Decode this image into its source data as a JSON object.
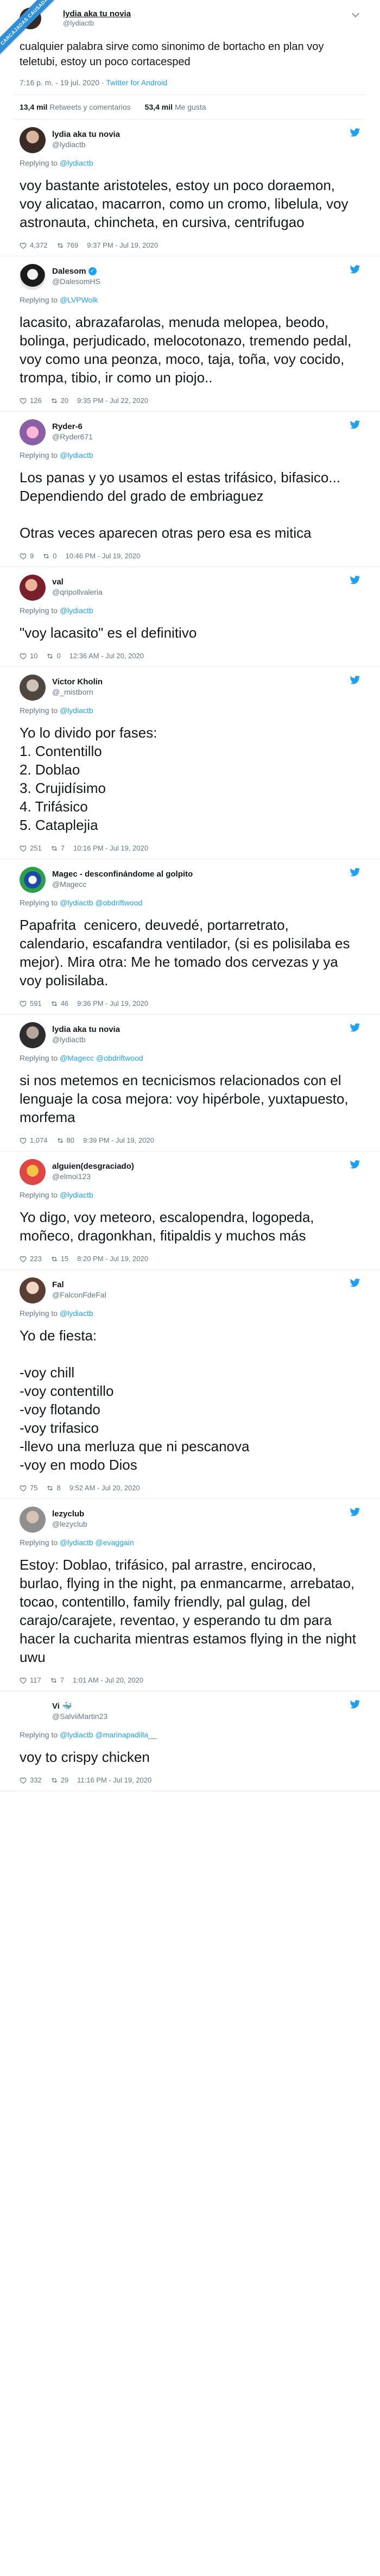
{
  "ribbon": "CARCAJADAS CAUSADAS",
  "main": {
    "name": "lydia aka tu novia",
    "handle": "@lydiactb",
    "text": "cualquier palabra sirve como sinonimo de bortacho en plan voy teletubi, estoy un poco cortacesped",
    "time": "7:16 p. m. - 19 jul. 2020 · ",
    "source": "Twitter for Android",
    "retweets_count": "13,4 mil",
    "retweets_label": "Retweets y comentarios",
    "likes_count": "53,4 mil",
    "likes_label": "Me gusta"
  },
  "replies": [
    {
      "name": "lydia aka tu novia",
      "handle": "@lydiactb",
      "verified": false,
      "replying_prefix": "Replying to ",
      "replying_to": "@lydiactb",
      "text": "voy bastante aristoteles, estoy un poco doraemon, voy alicatao, macarron, como un cromo, libelula, voy astronauta, chincheta, en cursiva, centrifugao",
      "likes": "4,372",
      "retweets": "769",
      "time": "9:37 PM - Jul 19, 2020"
    },
    {
      "name": "Dalesom",
      "handle": "@DalesomHS",
      "verified": true,
      "replying_prefix": "Replying to ",
      "replying_to": "@LVPWolk",
      "text": "lacasito, abrazafarolas, menuda melopea, beodo, bolinga, perjudicado, melocotonazo, tremendo pedal, voy como una peonza, moco, taja, toña, voy cocido, trompa, tibio, ir como un piojo..",
      "likes": "126",
      "retweets": "20",
      "time": "9:35 PM - Jul 22, 2020"
    },
    {
      "name": "Ryder-6",
      "handle": "@Ryder671",
      "verified": false,
      "replying_prefix": "Replying to ",
      "replying_to": "@lydiactb",
      "text": "Los panas y yo usamos el estas trifásico, bifasico... Dependiendo del grado de embriaguez\n\nOtras veces aparecen otras pero esa es mitica",
      "likes": "9",
      "retweets": "0",
      "time": "10:46 PM - Jul 19, 2020"
    },
    {
      "name": "val",
      "handle": "@qripollvaleria",
      "verified": false,
      "replying_prefix": "Replying to ",
      "replying_to": "@lydiactb",
      "text": "\"voy lacasito\" es el definitivo",
      "likes": "10",
      "retweets": "0",
      "time": "12:36 AM - Jul 20, 2020"
    },
    {
      "name": "Victor Kholin",
      "handle": "@_mistborn",
      "verified": false,
      "replying_prefix": "Replying to ",
      "replying_to": "@lydiactb",
      "text": "Yo lo divido por fases:\n1. Contentillo\n2. Doblao\n3. Crujidísimo\n4. Trifásico\n5. Cataplejia",
      "likes": "251",
      "retweets": "7",
      "time": "10:16 PM - Jul 19, 2020"
    },
    {
      "name": "Magec - desconfinándome al golpito",
      "handle": "@Magecc",
      "verified": false,
      "replying_prefix": "Replying to ",
      "replying_to": "@lydiactb @obdriftwood",
      "text": "Papafrita  cenicero, deuvedé, portarretrato, calendario, escafandra ventilador, (si es polisilaba es mejor). Mira otra: Me he tomado dos cervezas y ya voy polisilaba.",
      "likes": "591",
      "retweets": "46",
      "time": "9:36 PM - Jul 19, 2020"
    },
    {
      "name": "lydia aka tu novia",
      "handle": "@lydiactb",
      "verified": false,
      "replying_prefix": "Replying to ",
      "replying_to": "@Magecc @obdriftwood",
      "text": "si nos metemos en tecnicismos relacionados con el lenguaje la cosa mejora: voy hipérbole, yuxtapuesto, morfema",
      "likes": "1,074",
      "retweets": "80",
      "time": "9:39 PM - Jul 19, 2020"
    },
    {
      "name": "alguien(desgraciado)",
      "handle": "@elmoi123",
      "verified": false,
      "replying_prefix": "Replying to ",
      "replying_to": "@lydiactb",
      "text": "Yo digo, voy meteoro, escalopendra, logopeda, moñeco, dragonkhan, fitipaldis y muchos más",
      "likes": "223",
      "retweets": "15",
      "time": "8:20 PM - Jul 19, 2020"
    },
    {
      "name": "Fal",
      "handle": "@FalconFdeFal",
      "verified": false,
      "replying_prefix": "Replying to ",
      "replying_to": "@lydiactb",
      "text": "Yo de fiesta:\n\n-voy chill\n-voy contentillo\n-voy flotando\n-voy trifasico\n-llevo una merluza que ni pescanova\n-voy en modo Dios",
      "likes": "75",
      "retweets": "8",
      "time": "9:52 AM - Jul 20, 2020"
    },
    {
      "name": "lezyclub",
      "handle": "@lezyclub",
      "verified": false,
      "replying_prefix": "Replying to ",
      "replying_to": "@lydiactb @evaggain",
      "text": "Estoy: Doblao, trifásico, pal arrastre, encirocao, burlao, flying in the night, pa enmancarme, arrebatao, tocao, contentillo, family friendly, pal gulag, del carajo/carajete, reventao, y esperando tu dm para hacer la cucharita mientras estamos flying in the night uwu",
      "likes": "117",
      "retweets": "7",
      "time": "1:01 AM - Jul 20, 2020"
    },
    {
      "name": "Vi 🐳",
      "handle": "@SalviiMartin23",
      "verified": false,
      "replying_prefix": "Replying to ",
      "replying_to": "@lydiactb @marinapadilla__",
      "text": "voy to crispy chicken",
      "likes": "332",
      "retweets": "29",
      "time": "11:16 PM - Jul 19, 2020"
    }
  ],
  "colors": {
    "accent": "#1da1f2",
    "text": "#14171a",
    "muted": "#657786",
    "ribbon": "#2f8fd8"
  }
}
